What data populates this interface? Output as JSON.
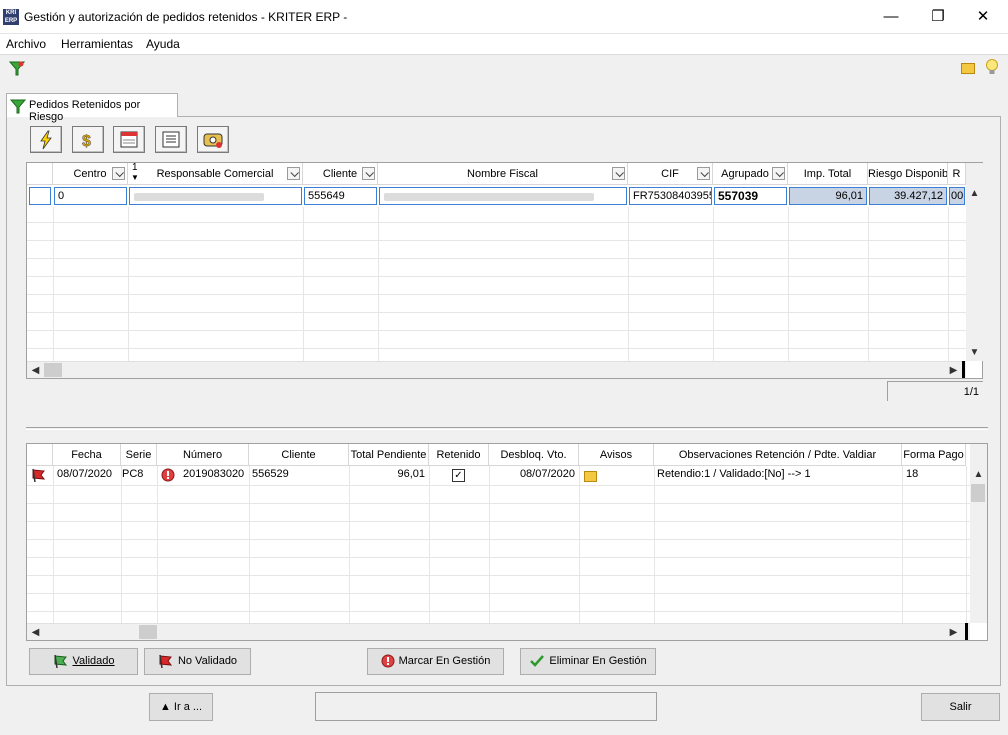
{
  "window": {
    "title": "Gestión y autorización de pedidos retenidos - KRITER ERP -",
    "app_icon": "KRI ERP",
    "min": "—",
    "max": "❐",
    "close": "✕"
  },
  "menu": [
    "Archivo",
    "Herramientas",
    "Ayuda"
  ],
  "tab": {
    "label": "Pedidos Retenidos por Riesgo"
  },
  "top_grid": {
    "sort_marker": "1",
    "headers": [
      "Centro",
      "Responsable Comercial",
      "Cliente",
      "Nombre Fiscal",
      "CIF",
      "Agrupado",
      "Imp. Total",
      "Riesgo Disponible",
      "R"
    ],
    "row": {
      "centro": "0",
      "cliente": "555649",
      "cif": "FR75308403955",
      "agrupado": "557039",
      "imp_total": "96,01",
      "riesgo": "39.427,12",
      "r": "00"
    },
    "pager": "1/1"
  },
  "bottom_grid": {
    "headers": [
      "Fecha",
      "Serie",
      "Número",
      "Cliente",
      "Total Pendiente",
      "Retenido",
      "Desbloq. Vto.",
      "Avisos",
      "Observaciones Retención / Pdte. Valdiar",
      "Forma Pago"
    ],
    "row": {
      "fecha": "08/07/2020",
      "serie": "PC8",
      "numero": "2019083020",
      "cliente": "556529",
      "total": "96,01",
      "retenido": "✓",
      "desbloq": "08/07/2020",
      "observaciones": "Retendio:1 / Validado:[No] --> 1",
      "forma_pago": "18"
    }
  },
  "buttons": {
    "validado": "Validado",
    "no_validado": "No Validado",
    "marcar": "Marcar En Gestión",
    "eliminar": "Eliminar En Gestión",
    "ir_a": "▲ Ir a ...",
    "salir": "Salir"
  },
  "colors": {
    "selection_border": "#3c7fd6",
    "total_cells": "#c8d3e3"
  }
}
